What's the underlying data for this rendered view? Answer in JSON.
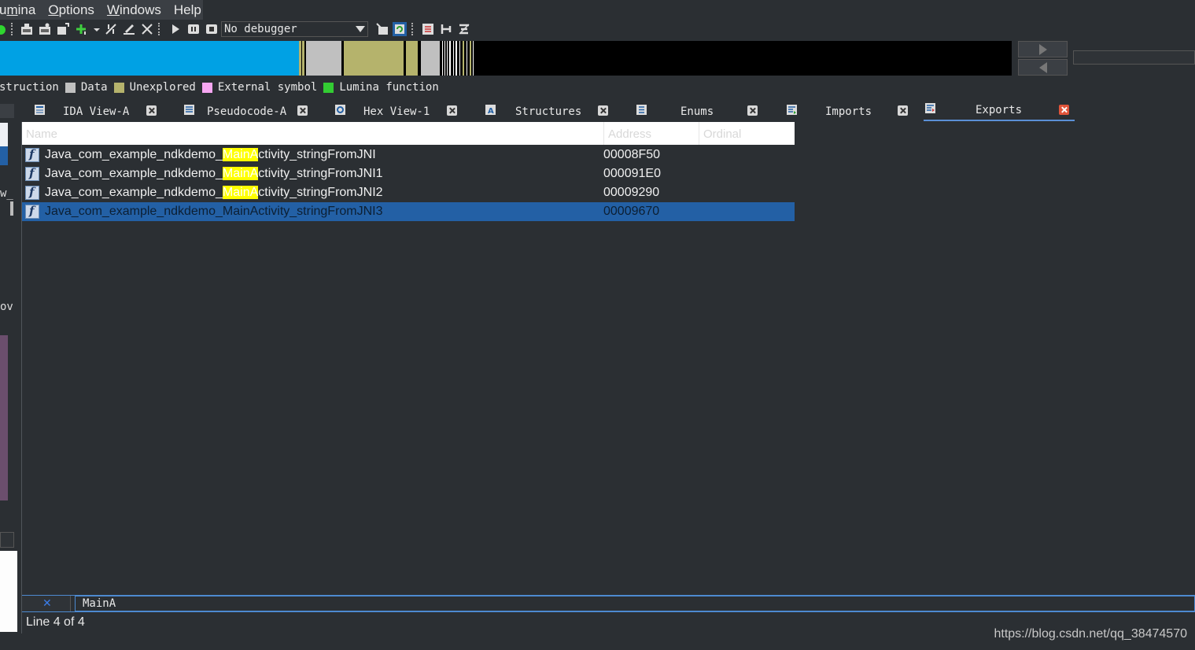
{
  "menu": {
    "items": [
      {
        "label": "umina",
        "underline": "m"
      },
      {
        "label": "Options",
        "underline": "O"
      },
      {
        "label": "Windows",
        "underline": "W"
      },
      {
        "label": "Help",
        "underline": ""
      }
    ]
  },
  "toolbar": {
    "debugger_value": "No debugger"
  },
  "legend": {
    "items": [
      {
        "label": "struction",
        "color": ""
      },
      {
        "label": "Data",
        "color": "#c0c0c0"
      },
      {
        "label": "Unexplored",
        "color": "#b5b36c"
      },
      {
        "label": "External symbol",
        "color": "#f7a7f2"
      },
      {
        "label": "Lumina function",
        "color": "#33cc33"
      }
    ]
  },
  "tabs": [
    {
      "label": "IDA View-A"
    },
    {
      "label": "Pseudocode-A"
    },
    {
      "label": "Hex View-1"
    },
    {
      "label": "Structures"
    },
    {
      "label": "Enums"
    },
    {
      "label": "Imports"
    },
    {
      "label": "Exports",
      "active": true
    }
  ],
  "table": {
    "columns": [
      "Name",
      "Address",
      "Ordinal"
    ],
    "rows": [
      {
        "name_pre": "Java_com_example_ndkdemo_",
        "name_hl": "MainA",
        "name_post": "ctivity_stringFromJNI",
        "address": "00008F50"
      },
      {
        "name_pre": "Java_com_example_ndkdemo_",
        "name_hl": "MainA",
        "name_post": "ctivity_stringFromJNI1",
        "address": "000091E0"
      },
      {
        "name_pre": "Java_com_example_ndkdemo_",
        "name_hl": "MainA",
        "name_post": "ctivity_stringFromJNI2",
        "address": "00009290"
      },
      {
        "name_pre": "Java_com_example_ndkdemo_MainActivity_stringFromJNI3",
        "name_hl": "",
        "name_post": "",
        "address": "00009670",
        "selected": true
      }
    ]
  },
  "search": {
    "value": "MainA"
  },
  "status": {
    "line": "Line 4 of 4"
  },
  "watermark": "https://blog.csdn.net/qq_38474570",
  "left_strip": {
    "fragments": [
      "w_",
      "ov"
    ]
  },
  "colors": {
    "accent": "#2360a5",
    "highlight": "#ffff00",
    "nav_code": "#00a1e4",
    "nav_unexplored": "#b5b36c",
    "nav_data": "#c0c0c0",
    "close_active": "#e0543a"
  }
}
